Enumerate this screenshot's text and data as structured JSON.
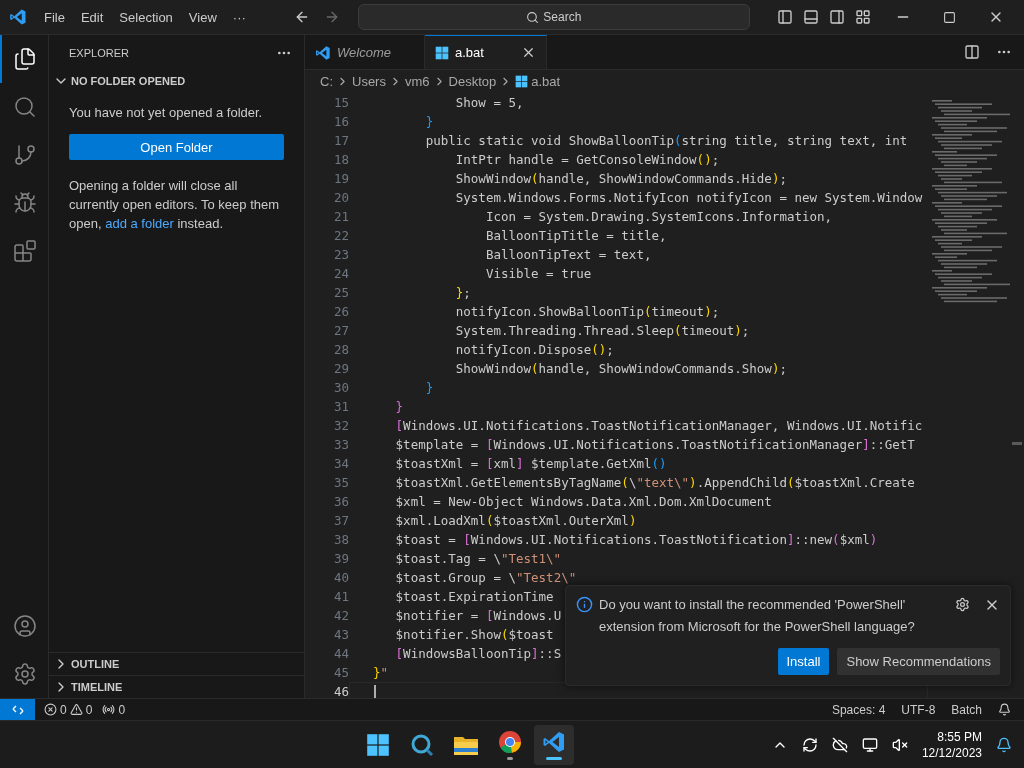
{
  "title_bar": {
    "menu": [
      "File",
      "Edit",
      "Selection",
      "View",
      "···"
    ],
    "search": {
      "placeholder": "Search"
    }
  },
  "activity_bar": [
    {
      "kind": "files",
      "selected": true
    },
    {
      "kind": "search",
      "selected": false
    },
    {
      "kind": "scm",
      "selected": false
    },
    {
      "kind": "debug",
      "selected": false
    },
    {
      "kind": "extensions",
      "selected": false
    }
  ],
  "sidebar": {
    "title": "EXPLORER",
    "section": {
      "title": "NO FOLDER OPENED",
      "expanded": true
    },
    "message": "You have not yet opened a folder.",
    "button": "Open Folder",
    "note_before": "Opening a folder will close all currently open editors. To keep them open,",
    "link": "add a folder",
    "note_after": "instead.",
    "panels": [
      {
        "title": "OUTLINE",
        "expanded": false
      },
      {
        "title": "TIMELINE",
        "expanded": false
      }
    ]
  },
  "tabs": [
    {
      "label": "Welcome",
      "kind": "welcome",
      "selected": false
    },
    {
      "label": "a.bat",
      "kind": "batch",
      "selected": true
    }
  ],
  "breadcrumbs": [
    "C:",
    "Users",
    "vm6",
    "Desktop",
    "a.bat"
  ],
  "editor": {
    "lines": [
      {
        "number": "15",
        "current": false,
        "segments": [
          {
            "kind": "text",
            "text": "           Show = 5,"
          }
        ]
      },
      {
        "number": "16",
        "current": false,
        "segments": [
          {
            "kind": "bracket3",
            "text": "       }"
          }
        ]
      },
      {
        "number": "17",
        "current": false,
        "segments": [
          {
            "kind": "text",
            "text": "       public static void ShowBalloonTip"
          },
          {
            "kind": "bracket3",
            "text": "("
          },
          {
            "kind": "text",
            "text": "string title, string text, int"
          }
        ]
      },
      {
        "number": "18",
        "current": false,
        "segments": [
          {
            "kind": "text",
            "text": "           IntPtr handle = GetConsoleWindow"
          },
          {
            "kind": "bracket1",
            "text": "()"
          },
          {
            "kind": "text",
            "text": ";"
          }
        ]
      },
      {
        "number": "19",
        "current": false,
        "segments": [
          {
            "kind": "text",
            "text": "           ShowWindow"
          },
          {
            "kind": "bracket1",
            "text": "("
          },
          {
            "kind": "text",
            "text": "handle, ShowWindowCommands.Hide"
          },
          {
            "kind": "bracket1",
            "text": ")"
          },
          {
            "kind": "text",
            "text": ";"
          }
        ]
      },
      {
        "number": "20",
        "current": false,
        "segments": [
          {
            "kind": "text",
            "text": "           System.Windows.Forms.NotifyIcon notifyIcon = new System.Window"
          }
        ]
      },
      {
        "number": "21",
        "current": false,
        "segments": [
          {
            "kind": "text",
            "text": "               Icon = System.Drawing.SystemIcons.Information,"
          }
        ]
      },
      {
        "number": "22",
        "current": false,
        "segments": [
          {
            "kind": "text",
            "text": "               BalloonTipTitle = title,"
          }
        ]
      },
      {
        "number": "23",
        "current": false,
        "segments": [
          {
            "kind": "text",
            "text": "               BalloonTipText = text,"
          }
        ]
      },
      {
        "number": "24",
        "current": false,
        "segments": [
          {
            "kind": "text",
            "text": "               Visible = true"
          }
        ]
      },
      {
        "number": "25",
        "current": false,
        "segments": [
          {
            "kind": "bracket1",
            "text": "           }"
          },
          {
            "kind": "text",
            "text": ";"
          }
        ]
      },
      {
        "number": "26",
        "current": false,
        "segments": [
          {
            "kind": "text",
            "text": "           notifyIcon.ShowBalloonTip"
          },
          {
            "kind": "bracket1",
            "text": "("
          },
          {
            "kind": "text",
            "text": "timeout"
          },
          {
            "kind": "bracket1",
            "text": ")"
          },
          {
            "kind": "text",
            "text": ";"
          }
        ]
      },
      {
        "number": "27",
        "current": false,
        "segments": [
          {
            "kind": "text",
            "text": "           System.Threading.Thread.Sleep"
          },
          {
            "kind": "bracket1",
            "text": "("
          },
          {
            "kind": "text",
            "text": "timeout"
          },
          {
            "kind": "bracket1",
            "text": ")"
          },
          {
            "kind": "text",
            "text": ";"
          }
        ]
      },
      {
        "number": "28",
        "current": false,
        "segments": [
          {
            "kind": "text",
            "text": "           notifyIcon.Dispose"
          },
          {
            "kind": "bracket1",
            "text": "()"
          },
          {
            "kind": "text",
            "text": ";"
          }
        ]
      },
      {
        "number": "29",
        "current": false,
        "segments": [
          {
            "kind": "text",
            "text": "           ShowWindow"
          },
          {
            "kind": "bracket1",
            "text": "("
          },
          {
            "kind": "text",
            "text": "handle, ShowWindowCommands.Show"
          },
          {
            "kind": "bracket1",
            "text": ")"
          },
          {
            "kind": "text",
            "text": ";"
          }
        ]
      },
      {
        "number": "30",
        "current": false,
        "segments": [
          {
            "kind": "bracket3",
            "text": "       }"
          }
        ]
      },
      {
        "number": "31",
        "current": false,
        "segments": [
          {
            "kind": "bracket2",
            "text": "   }"
          }
        ]
      },
      {
        "number": "32",
        "current": false,
        "segments": [
          {
            "kind": "bracket2",
            "text": "   ["
          },
          {
            "kind": "text",
            "text": "Windows.UI.Notifications.ToastNotificationManager, Windows.UI.Notific"
          }
        ]
      },
      {
        "number": "33",
        "current": false,
        "segments": [
          {
            "kind": "text",
            "text": "   $template = "
          },
          {
            "kind": "bracket2",
            "text": "["
          },
          {
            "kind": "text",
            "text": "Windows.UI.Notifications.ToastNotificationManager"
          },
          {
            "kind": "bracket2",
            "text": "]"
          },
          {
            "kind": "text",
            "text": "::GetT"
          }
        ]
      },
      {
        "number": "34",
        "current": false,
        "segments": [
          {
            "kind": "text",
            "text": "   $toastXml = "
          },
          {
            "kind": "bracket2",
            "text": "["
          },
          {
            "kind": "text",
            "text": "xml"
          },
          {
            "kind": "bracket2",
            "text": "]"
          },
          {
            "kind": "text",
            "text": " $template.GetXml"
          },
          {
            "kind": "bracket3",
            "text": "()"
          }
        ]
      },
      {
        "number": "35",
        "current": false,
        "segments": [
          {
            "kind": "text",
            "text": "   $toastXml.GetElementsByTagName"
          },
          {
            "kind": "bracket1",
            "text": "("
          },
          {
            "kind": "text",
            "text": "\\"
          },
          {
            "kind": "string",
            "text": "\"text\\\""
          },
          {
            "kind": "bracket1",
            "text": ")"
          },
          {
            "kind": "text",
            "text": ".AppendChild"
          },
          {
            "kind": "bracket1",
            "text": "("
          },
          {
            "kind": "text",
            "text": "$toastXml.Create"
          }
        ]
      },
      {
        "number": "36",
        "current": false,
        "segments": [
          {
            "kind": "text",
            "text": "   $xml = New-Object Windows.Data.Xml.Dom.XmlDocument"
          }
        ]
      },
      {
        "number": "37",
        "current": false,
        "segments": [
          {
            "kind": "text",
            "text": "   $xml.LoadXml"
          },
          {
            "kind": "bracket1",
            "text": "("
          },
          {
            "kind": "text",
            "text": "$toastXml.OuterXml"
          },
          {
            "kind": "bracket1",
            "text": ")"
          }
        ]
      },
      {
        "number": "38",
        "current": false,
        "segments": [
          {
            "kind": "text",
            "text": "   $toast = "
          },
          {
            "kind": "bracket2",
            "text": "["
          },
          {
            "kind": "text",
            "text": "Windows.UI.Notifications.ToastNotification"
          },
          {
            "kind": "bracket2",
            "text": "]"
          },
          {
            "kind": "text",
            "text": "::new"
          },
          {
            "kind": "bracket2",
            "text": "("
          },
          {
            "kind": "text",
            "text": "$xml"
          },
          {
            "kind": "bracket2",
            "text": ")"
          }
        ]
      },
      {
        "number": "39",
        "current": false,
        "segments": [
          {
            "kind": "text",
            "text": "   $toast.Tag = \\"
          },
          {
            "kind": "string",
            "text": "\"Test1\\\""
          }
        ]
      },
      {
        "number": "40",
        "current": false,
        "segments": [
          {
            "kind": "text",
            "text": "   $toast.Group = \\"
          },
          {
            "kind": "string",
            "text": "\"Test2\\\""
          }
        ]
      },
      {
        "number": "41",
        "current": false,
        "segments": [
          {
            "kind": "text",
            "text": "   $toast.ExpirationTime"
          }
        ]
      },
      {
        "number": "42",
        "current": false,
        "segments": [
          {
            "kind": "text",
            "text": "   $notifier = "
          },
          {
            "kind": "bracket2",
            "text": "["
          },
          {
            "kind": "text",
            "text": "Windows.U"
          }
        ]
      },
      {
        "number": "43",
        "current": false,
        "segments": [
          {
            "kind": "text",
            "text": "   $notifier.Show"
          },
          {
            "kind": "bracket1",
            "text": "("
          },
          {
            "kind": "text",
            "text": "$toast"
          }
        ]
      },
      {
        "number": "44",
        "current": false,
        "segments": [
          {
            "kind": "bracket2",
            "text": "   ["
          },
          {
            "kind": "text",
            "text": "WindowsBalloonTip"
          },
          {
            "kind": "bracket2",
            "text": "]"
          },
          {
            "kind": "text",
            "text": "::S"
          }
        ]
      },
      {
        "number": "45",
        "current": false,
        "segments": [
          {
            "kind": "bracket1",
            "text": "}"
          },
          {
            "kind": "string",
            "text": "\""
          }
        ]
      },
      {
        "number": "46",
        "current": true
      }
    ]
  },
  "notification": {
    "message": "Do you want to install the recommended 'PowerShell' extension from Microsoft for the PowerShell language?",
    "buttons": [
      {
        "label": "Install",
        "kind": "primary"
      },
      {
        "label": "Show Recommendations",
        "kind": "secondary"
      }
    ]
  },
  "status_bar": {
    "errors": "0",
    "warnings": "0",
    "ports": "0",
    "items": [
      "Spaces: 4",
      "UTF-8",
      "Batch"
    ]
  },
  "taskbar": {
    "apps": [
      {
        "kind": "start",
        "selected": false,
        "running": false
      },
      {
        "kind": "search",
        "selected": false,
        "running": false
      },
      {
        "kind": "files",
        "selected": false,
        "running": false
      },
      {
        "kind": "browser",
        "selected": false,
        "running": true
      },
      {
        "kind": "code",
        "selected": true,
        "running": true
      }
    ],
    "time": "8:55 PM",
    "date": "12/12/2023"
  }
}
